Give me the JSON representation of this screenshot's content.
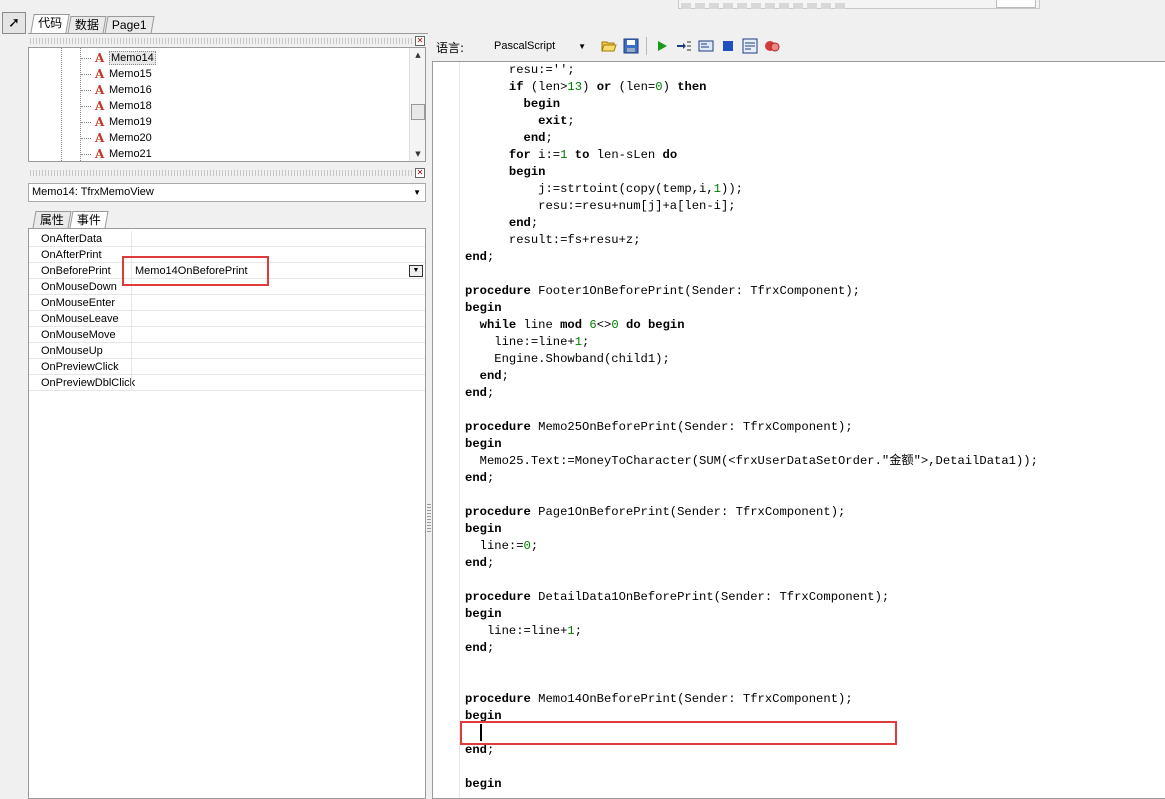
{
  "tabs": [
    "代码",
    "数据",
    "Page1"
  ],
  "tree": {
    "items": [
      "Memo14",
      "Memo15",
      "Memo16",
      "Memo18",
      "Memo19",
      "Memo20",
      "Memo21"
    ],
    "selected": "Memo14"
  },
  "object_combo": "Memo14: TfrxMemoView",
  "inspector_tabs": [
    "属性",
    "事件"
  ],
  "events": [
    {
      "name": "OnAfterData",
      "value": ""
    },
    {
      "name": "OnAfterPrint",
      "value": ""
    },
    {
      "name": "OnBeforePrint",
      "value": "Memo14OnBeforePrint"
    },
    {
      "name": "OnMouseDown",
      "value": ""
    },
    {
      "name": "OnMouseEnter",
      "value": ""
    },
    {
      "name": "OnMouseLeave",
      "value": ""
    },
    {
      "name": "OnMouseMove",
      "value": ""
    },
    {
      "name": "OnMouseUp",
      "value": ""
    },
    {
      "name": "OnPreviewClick",
      "value": ""
    },
    {
      "name": "OnPreviewDblClick",
      "value": ""
    }
  ],
  "editor_toolbar": {
    "language_label": "语言:",
    "language_value": "PascalScript",
    "icons": [
      "open-icon",
      "save-icon",
      "run-icon",
      "step-into-icon",
      "step-over-icon",
      "stop-icon",
      "evaluate-icon",
      "breakpoint-icon"
    ]
  },
  "code_lines": [
    "      resu:='';",
    "      if (len>13) or (len=0) then",
    "        begin",
    "          exit;",
    "        end;",
    "      for i:=1 to len-sLen do",
    "      begin",
    "          j:=strtoint(copy(temp,i,1));",
    "          resu:=resu+num[j]+a[len-i];",
    "      end;",
    "      result:=fs+resu+z;",
    "end;",
    "",
    "procedure Footer1OnBeforePrint(Sender: TfrxComponent);",
    "begin",
    "  while line mod 6<>0 do begin",
    "    line:=line+1;",
    "    Engine.Showband(child1);",
    "  end;",
    "end;",
    "",
    "procedure Memo25OnBeforePrint(Sender: TfrxComponent);",
    "begin",
    "  Memo25.Text:=MoneyToCharacter(SUM(<frxUserDataSetOrder.\"金额\">,DetailData1));",
    "end;",
    "",
    "procedure Page1OnBeforePrint(Sender: TfrxComponent);",
    "begin",
    "  line:=0;",
    "end;",
    "",
    "procedure DetailData1OnBeforePrint(Sender: TfrxComponent);",
    "begin",
    "   line:=line+1;",
    "end;",
    "",
    "",
    "procedure Memo14OnBeforePrint(Sender: TfrxComponent);",
    "begin",
    "  ",
    "end;",
    "",
    "begin"
  ]
}
